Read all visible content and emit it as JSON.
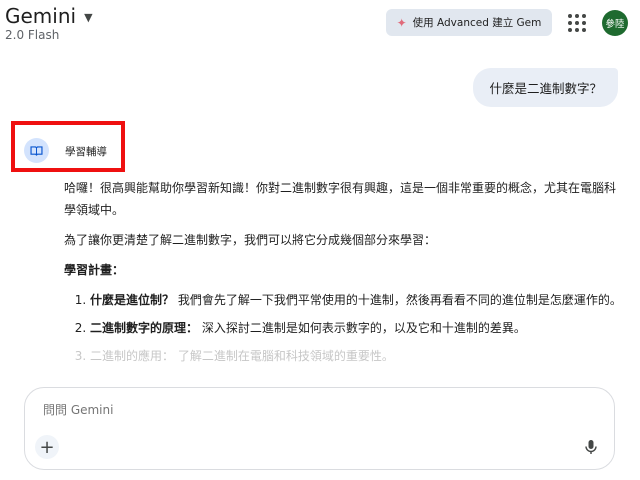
{
  "header": {
    "app_title": "Gemini",
    "model_name": "2.0 Flash",
    "upgrade_button": "使用 Advanced 建立 Gem",
    "avatar_text": "參陸"
  },
  "conversation": {
    "user_message": "什麼是二進制數字？",
    "bot_name": "學習輔導",
    "paragraphs": [
      "哈囉！很高興能幫助你學習新知識！你對二進制數字很有興趣，這是一個非常重要的概念，尤其在電腦科學領域中。",
      "為了讓你更清楚了解二進制數字，我們可以將它分成幾個部分來學習："
    ],
    "plan_heading": "學習計畫：",
    "plan_items": [
      {
        "title": "什麼是進位制？",
        "text": " 我們會先了解一下我們平常使用的十進制，然後再看看不同的進位制是怎麼運作的。"
      },
      {
        "title": "二進制數字的原理：",
        "text": " 深入探討二進制是如何表示數字的，以及它和十進制的差異。"
      },
      {
        "title": "二進制的應用：",
        "text": " 了解二進制在電腦和科技領域的重要性。"
      }
    ]
  },
  "input": {
    "placeholder": "問問 Gemini"
  },
  "colors": {
    "accent_blue": "#d3e3fd",
    "highlight_red": "#ef1010",
    "avatar_green": "#1e6a2f"
  }
}
